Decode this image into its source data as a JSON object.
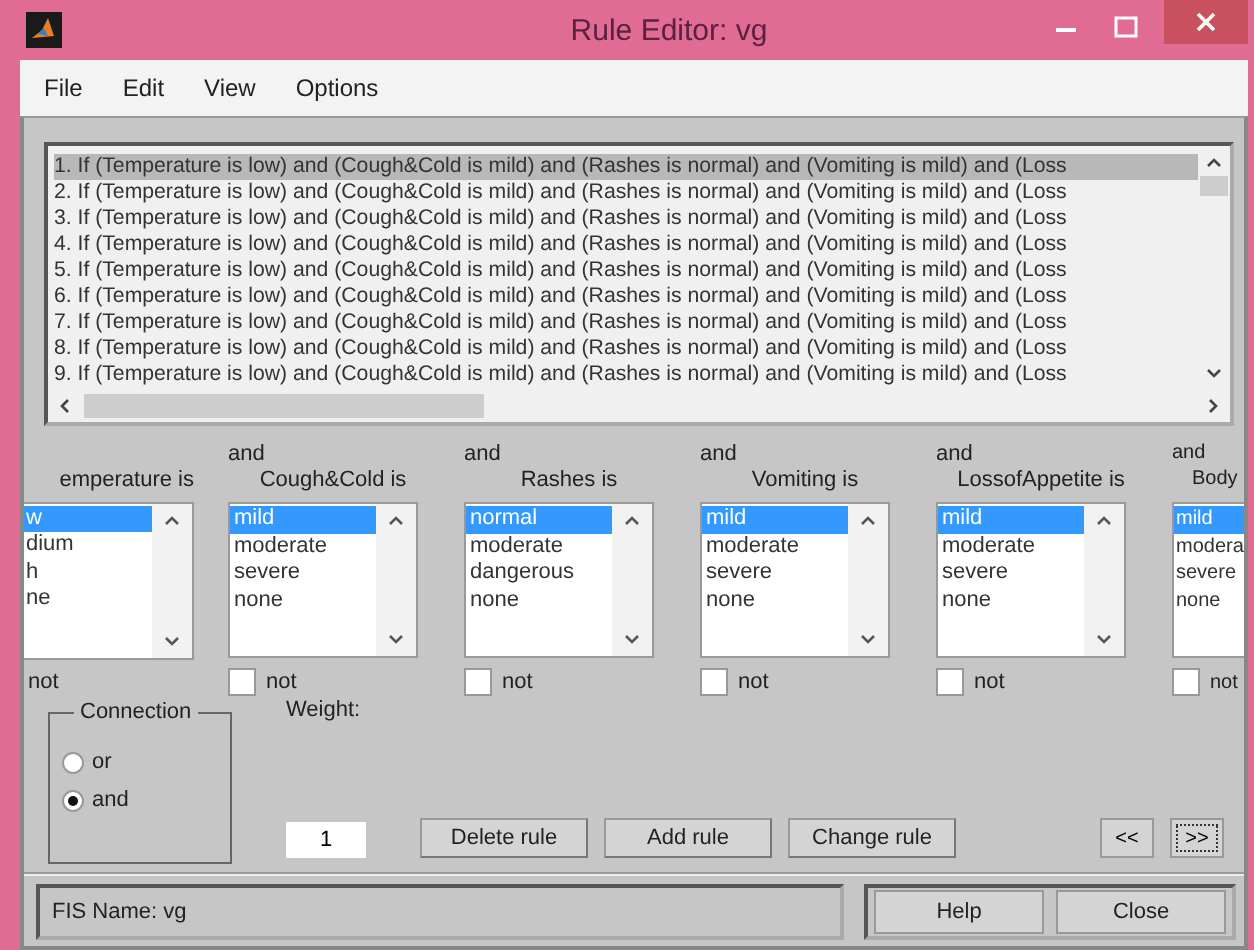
{
  "window": {
    "title": "Rule Editor: vg"
  },
  "menu": [
    "File",
    "Edit",
    "View",
    "Options"
  ],
  "rules": [
    {
      "text": "1. If (Temperature is low) and (Cough&Cold is mild) and (Rashes is normal) and (Vomiting is mild) and (Loss",
      "selected": true
    },
    {
      "text": "2. If (Temperature is low) and (Cough&Cold is mild) and (Rashes is normal) and (Vomiting is mild) and (Loss",
      "selected": false
    },
    {
      "text": "3. If (Temperature is low) and (Cough&Cold is mild) and (Rashes is normal) and (Vomiting is mild) and (Loss",
      "selected": false
    },
    {
      "text": "4. If (Temperature is low) and (Cough&Cold is mild) and (Rashes is normal) and (Vomiting is mild) and (Loss",
      "selected": false
    },
    {
      "text": "5. If (Temperature is low) and (Cough&Cold is mild) and (Rashes is normal) and (Vomiting is mild) and (Loss",
      "selected": false
    },
    {
      "text": "6. If (Temperature is low) and (Cough&Cold is mild) and (Rashes is normal) and (Vomiting is mild) and (Loss",
      "selected": false
    },
    {
      "text": "7. If (Temperature is low) and (Cough&Cold is mild) and (Rashes is normal) and (Vomiting is mild) and (Loss",
      "selected": false
    },
    {
      "text": "8. If (Temperature is low) and (Cough&Cold is mild) and (Rashes is normal) and (Vomiting is mild) and (Loss",
      "selected": false
    },
    {
      "text": "9. If (Temperature is low) and (Cough&Cold is mild) and (Rashes is normal) and (Vomiting is mild) and (Loss",
      "selected": false
    }
  ],
  "variables": [
    {
      "label": "emperature is",
      "options": [
        {
          "text": "w",
          "selected": true
        },
        {
          "text": "dium",
          "selected": false
        },
        {
          "text": "h",
          "selected": false
        },
        {
          "text": "ne",
          "selected": false
        }
      ],
      "not_label": "not"
    },
    {
      "connective": "and",
      "label": "Cough&Cold is",
      "options": [
        {
          "text": "mild",
          "selected": true
        },
        {
          "text": "moderate",
          "selected": false
        },
        {
          "text": "severe",
          "selected": false
        },
        {
          "text": "none",
          "selected": false
        }
      ],
      "not_label": "not",
      "not_checked": false
    },
    {
      "connective": "and",
      "label": "Rashes is",
      "options": [
        {
          "text": "normal",
          "selected": true
        },
        {
          "text": "moderate",
          "selected": false
        },
        {
          "text": "dangerous",
          "selected": false
        },
        {
          "text": "none",
          "selected": false
        }
      ],
      "not_label": "not",
      "not_checked": false
    },
    {
      "connective": "and",
      "label": "Vomiting is",
      "options": [
        {
          "text": "mild",
          "selected": true
        },
        {
          "text": "moderate",
          "selected": false
        },
        {
          "text": "severe",
          "selected": false
        },
        {
          "text": "none",
          "selected": false
        }
      ],
      "not_label": "not",
      "not_checked": false
    },
    {
      "connective": "and",
      "label": "LossofAppetite is",
      "options": [
        {
          "text": "mild",
          "selected": true
        },
        {
          "text": "moderate",
          "selected": false
        },
        {
          "text": "severe",
          "selected": false
        },
        {
          "text": "none",
          "selected": false
        }
      ],
      "not_label": "not",
      "not_checked": false
    },
    {
      "connective": "and",
      "label": "Body",
      "options": [
        {
          "text": "mild",
          "selected": true
        },
        {
          "text": "modera",
          "selected": false
        },
        {
          "text": "severe",
          "selected": false
        },
        {
          "text": "none",
          "selected": false
        }
      ],
      "not_label": "not",
      "not_checked": false
    }
  ],
  "connection": {
    "title": "Connection",
    "options": [
      {
        "label": "or",
        "selected": false
      },
      {
        "label": "and",
        "selected": true
      }
    ]
  },
  "weight": {
    "label": "Weight:",
    "value": "1"
  },
  "rule_buttons": [
    "Delete rule",
    "Add rule",
    "Change rule"
  ],
  "nav_buttons": [
    {
      "label": "<<",
      "focused": false
    },
    {
      "label": ">>",
      "focused": true
    }
  ],
  "status": "FIS Name: vg",
  "footer_buttons": [
    "Help",
    "Close"
  ]
}
